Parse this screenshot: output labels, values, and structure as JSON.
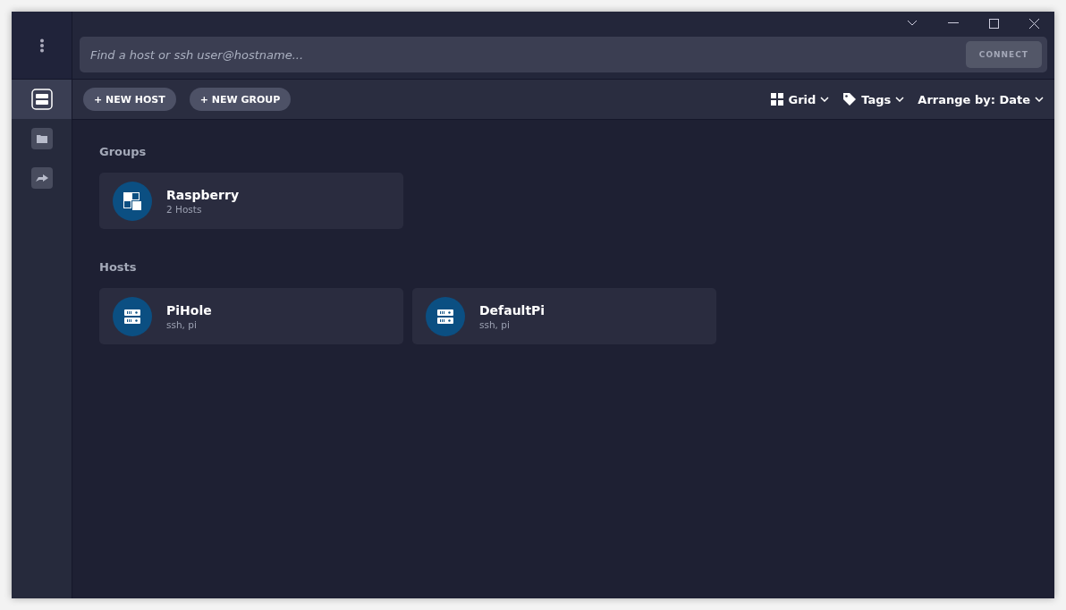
{
  "sidebar": {
    "items": [
      {
        "kind": "hosts",
        "selected": true
      },
      {
        "kind": "folder",
        "selected": false
      },
      {
        "kind": "forward",
        "selected": false
      }
    ]
  },
  "search": {
    "placeholder": "Find a host or ssh user@hostname...",
    "button": "CONNECT"
  },
  "toolbar": {
    "buttons": [
      "+ NEW HOST",
      "+ NEW GROUP"
    ],
    "view": "Grid",
    "tags": "Tags",
    "arrange": "Arrange by: Date"
  },
  "sections": [
    {
      "kind": "group",
      "title": "Groups",
      "cards": [
        {
          "name": "Raspberry",
          "detail": "2 Hosts"
        }
      ]
    },
    {
      "kind": "host",
      "title": "Hosts",
      "cards": [
        {
          "name": "PiHole",
          "detail": "ssh, pi"
        },
        {
          "name": "DefaultPi",
          "detail": "ssh, pi"
        }
      ]
    }
  ]
}
